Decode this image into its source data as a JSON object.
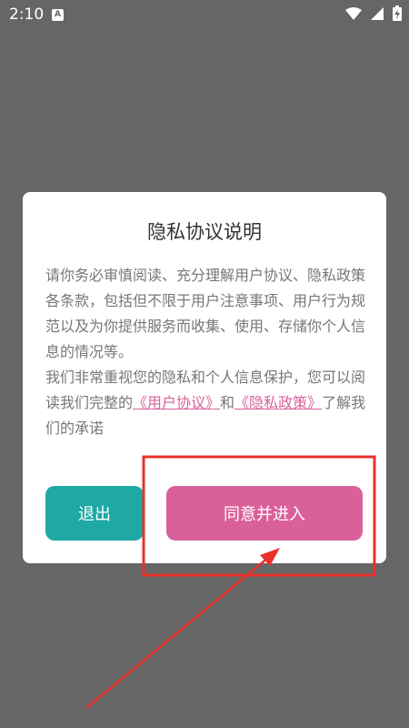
{
  "status_bar": {
    "time": "2:10",
    "badge": "A",
    "icons": [
      "wifi-icon",
      "signal-icon",
      "battery-charging-icon"
    ]
  },
  "dialog": {
    "title": "隐私协议说明",
    "paragraph1": "请你务必审慎阅读、充分理解用户协议、隐私政策各条款，包括但不限于用户注意事项、用户行为规范以及为你提供服务而收集、使用、存储你个人信息的情况等。",
    "paragraph2_prefix": "我们非常重视您的隐私和个人信息保护，您可以阅读我们完整的",
    "user_agreement_link": "《用户协议》",
    "and_text": "和",
    "privacy_policy_link": "《隐私政策》",
    "paragraph2_suffix": "了解我们的承诺",
    "exit_label": "退出",
    "agree_label": "同意并进入"
  },
  "colors": {
    "backdrop": "#666666",
    "accent_pink": "#d9609a",
    "accent_teal": "#1ea9a4",
    "annotation_red": "#e8312a"
  }
}
